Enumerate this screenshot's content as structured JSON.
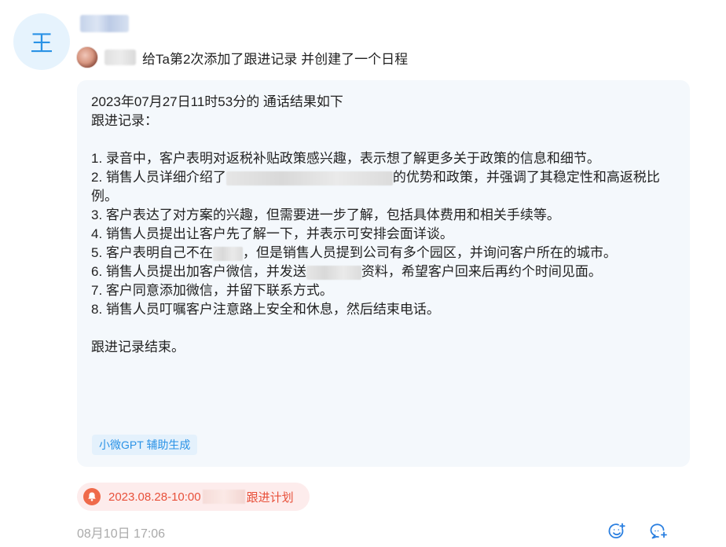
{
  "avatar": {
    "initial": "王",
    "bg_color": "#e6f3fd",
    "text_color": "#2a92e6"
  },
  "activity": {
    "action_text": "给Ta第2次添加了跟进记录 并创建了一个日程"
  },
  "record": {
    "header": "2023年07月27日11时53分的 通话结果如下",
    "subheader": "跟进记录：",
    "items": [
      {
        "text": "1. 录音中，客户表明对返税补贴政策感兴趣，表示想了解更多关于政策的信息和细节。"
      },
      {
        "prefix": "2. 销售人员详细介绍了",
        "suffix": "的优势和政策，并强调了其稳定性和高返税比例。"
      },
      {
        "text": "3. 客户表达了对方案的兴趣，但需要进一步了解，包括具体费用和相关手续等。"
      },
      {
        "text": "4. 销售人员提出让客户先了解一下，并表示可安排会面详谈。"
      },
      {
        "prefix": "5. 客户表明自己不在",
        "suffix": "，但是销售人员提到公司有多个园区，并询问客户所在的城市。"
      },
      {
        "prefix": "6. 销售人员提出加客户微信，并发送",
        "suffix": "资料，希望客户回来后再约个时间见面。"
      },
      {
        "text": "7. 客户同意添加微信，并留下联系方式。"
      },
      {
        "text": "8. 销售人员叮嘱客户注意路上安全和休息，然后结束电话。"
      }
    ],
    "footer": "跟进记录结束。",
    "tag": "小微GPT 辅助生成"
  },
  "plan": {
    "date": "2023.08.28-10:00",
    "label": "跟进计划",
    "accent_color": "#e8503a",
    "icon": "bell-icon"
  },
  "timestamp": "08月10日 17:06",
  "actions": [
    {
      "icon": "emoji-add-icon"
    },
    {
      "icon": "comment-add-icon"
    }
  ],
  "colors": {
    "brand_blue": "#2a92e6",
    "card_bg": "#f4f8fc",
    "muted": "#aaaaaa"
  }
}
